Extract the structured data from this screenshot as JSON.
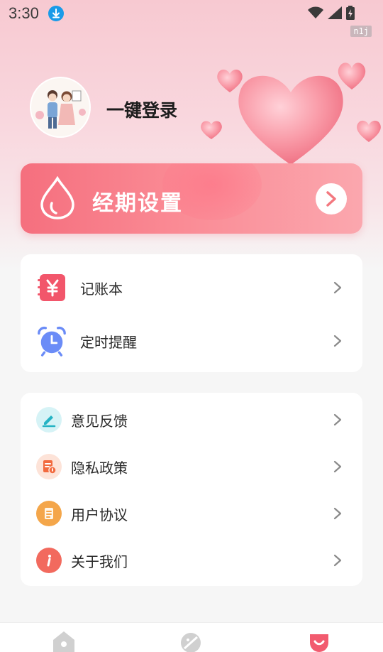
{
  "status_bar": {
    "time": "3:30",
    "watermark": "n1j"
  },
  "profile": {
    "login_label": "一键登录"
  },
  "banner": {
    "label": "经期设置"
  },
  "tools": [
    {
      "label": "记账本",
      "icon": "ledger-yen-icon"
    },
    {
      "label": "定时提醒",
      "icon": "alarm-clock-icon"
    }
  ],
  "settings": [
    {
      "label": "意见反馈",
      "icon": "pencil-feedback-icon"
    },
    {
      "label": "隐私政策",
      "icon": "privacy-doc-icon"
    },
    {
      "label": "用户协议",
      "icon": "agreement-doc-icon"
    },
    {
      "label": "关于我们",
      "icon": "info-icon"
    }
  ],
  "bottom_nav": [
    {
      "icon": "home-icon"
    },
    {
      "icon": "discover-icon"
    },
    {
      "icon": "profile-icon",
      "active": true
    }
  ],
  "colors": {
    "accent": "#f56f7e",
    "banner_end": "#fba7ae",
    "alarm": "#6b8cf7",
    "feedback": "#25b3c4",
    "privacy": "#f26a3f",
    "agreement": "#f4a64a",
    "info": "#f26a5e"
  }
}
